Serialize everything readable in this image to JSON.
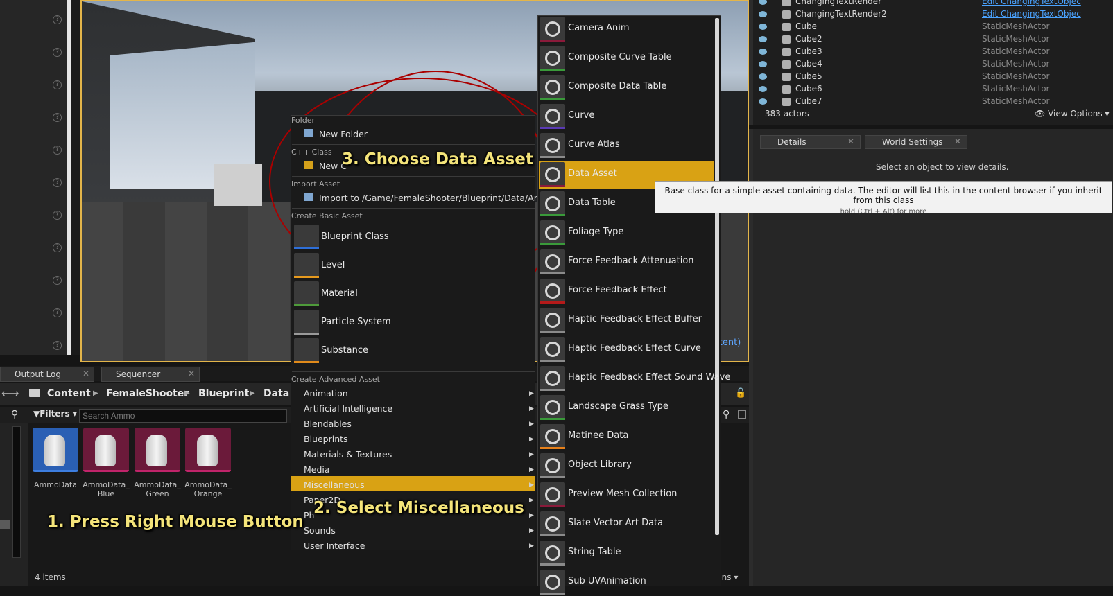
{
  "outliner": {
    "rows": [
      {
        "name": "ChangingTextRender",
        "type": "Edit ChangingTextObjec",
        "link": true
      },
      {
        "name": "ChangingTextRender2",
        "type": "Edit ChangingTextObjec",
        "link": true
      },
      {
        "name": "Cube",
        "type": "StaticMeshActor",
        "link": false
      },
      {
        "name": "Cube2",
        "type": "StaticMeshActor",
        "link": false
      },
      {
        "name": "Cube3",
        "type": "StaticMeshActor",
        "link": false
      },
      {
        "name": "Cube4",
        "type": "StaticMeshActor",
        "link": false
      },
      {
        "name": "Cube5",
        "type": "StaticMeshActor",
        "link": false
      },
      {
        "name": "Cube6",
        "type": "StaticMeshActor",
        "link": false
      },
      {
        "name": "Cube7",
        "type": "StaticMeshActor",
        "link": false
      }
    ],
    "actor_count": "383 actors",
    "view_options": "View Options"
  },
  "details": {
    "tabs": [
      "Details",
      "World Settings"
    ],
    "empty_message": "Select an object to view details."
  },
  "viewport": {
    "persistent_label": "stent)"
  },
  "tooltip": {
    "text": "Base class for a simple asset containing data. The editor will list this in the content browser if you inherit from this class",
    "hint": "hold (Ctrl + Alt) for more"
  },
  "bottom_tabs": [
    "Output Log",
    "Sequencer"
  ],
  "breadcrumb": [
    "Content",
    "FemaleShooter",
    "Blueprint",
    "Data"
  ],
  "filters_label": "Filters",
  "search_placeholder": "Search Ammo",
  "assets": [
    {
      "label": "AmmoData",
      "color": "#2a5fb4"
    },
    {
      "label": "AmmoData_\nBlue",
      "color": "#6b1a3a"
    },
    {
      "label": "AmmoData_\nGreen",
      "color": "#6b1a3a"
    },
    {
      "label": "AmmoData_\nOrange",
      "color": "#6b1a3a"
    }
  ],
  "item_count": "4 items",
  "options_fragment": "ions",
  "context_menu": {
    "sections": {
      "folder": "Folder",
      "cpp": "C++ Class",
      "import": "Import Asset",
      "basic": "Create Basic Asset",
      "advanced": "Create Advanced Asset"
    },
    "new_folder": "New Folder",
    "new_cpp": "New C",
    "import_to": "Import to /Game/FemaleShooter/Blueprint/Data/Ammo...",
    "basic_assets": [
      {
        "label": "Blueprint Class",
        "color": "#2e6fd8"
      },
      {
        "label": "Level",
        "color": "#e69a1e"
      },
      {
        "label": "Material",
        "color": "#4e9a3a"
      },
      {
        "label": "Particle System",
        "color": "#9a9a9a"
      },
      {
        "label": "Substance",
        "color": "#e08a1a"
      }
    ],
    "advanced_assets": [
      "Animation",
      "Artificial Intelligence",
      "Blendables",
      "Blueprints",
      "Materials & Textures",
      "Media",
      "Miscellaneous",
      "Paper2D",
      "Ph",
      "Sounds",
      "User Interface"
    ],
    "highlighted": "Miscellaneous"
  },
  "submenu": {
    "items": [
      {
        "label": "Camera Anim",
        "color": "#8a1a3a"
      },
      {
        "label": "Composite Curve Table",
        "color": "#3a9a3a"
      },
      {
        "label": "Composite Data Table",
        "color": "#3a9a3a"
      },
      {
        "label": "Curve",
        "color": "#5a3ab4"
      },
      {
        "label": "Curve Atlas",
        "color": "#8a8a8a"
      },
      {
        "label": "Data Asset",
        "color": "#8a1a3a"
      },
      {
        "label": "Data Table",
        "color": "#3a9a3a"
      },
      {
        "label": "Foliage Type",
        "color": "#3a9a3a"
      },
      {
        "label": "Force Feedback Attenuation",
        "color": "#8a8a8a"
      },
      {
        "label": "Force Feedback Effect",
        "color": "#b41a1a"
      },
      {
        "label": "Haptic Feedback Effect Buffer",
        "color": "#8a8a8a"
      },
      {
        "label": "Haptic Feedback Effect Curve",
        "color": "#8a8a8a"
      },
      {
        "label": "Haptic Feedback Effect Sound Wave",
        "color": "#8a8a8a"
      },
      {
        "label": "Landscape Grass Type",
        "color": "#3a9a3a"
      },
      {
        "label": "Matinee Data",
        "color": "#e6801a"
      },
      {
        "label": "Object Library",
        "color": "#8a8a8a"
      },
      {
        "label": "Preview Mesh Collection",
        "color": "#8a1a3a"
      },
      {
        "label": "Slate Vector Art Data",
        "color": "#8a8a8a"
      },
      {
        "label": "String Table",
        "color": "#8a8a8a"
      },
      {
        "label": "Sub UVAnimation",
        "color": "#8a8a8a"
      }
    ],
    "highlighted": "Data Asset"
  },
  "annotations": {
    "step1": "1. Press Right Mouse Button",
    "step2": "2. Select Miscellaneous",
    "step3": "3. Choose Data Asset"
  },
  "colors": {
    "accent": "#d9a214",
    "annotation": "#f4e47a"
  }
}
